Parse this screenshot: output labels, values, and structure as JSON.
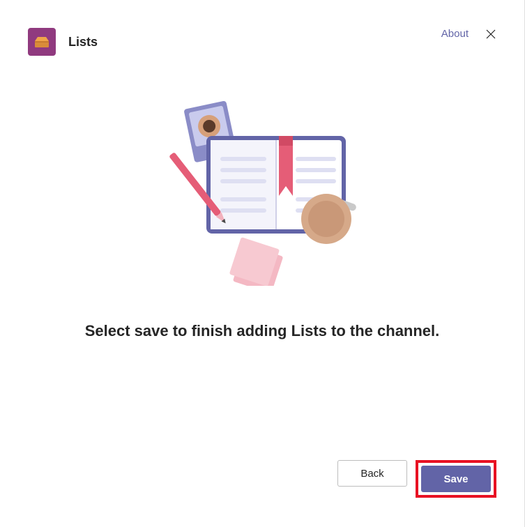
{
  "header": {
    "app_title": "Lists",
    "about_label": "About"
  },
  "body": {
    "instruction": "Select save to finish adding Lists to the channel."
  },
  "footer": {
    "back_label": "Back",
    "save_label": "Save"
  }
}
